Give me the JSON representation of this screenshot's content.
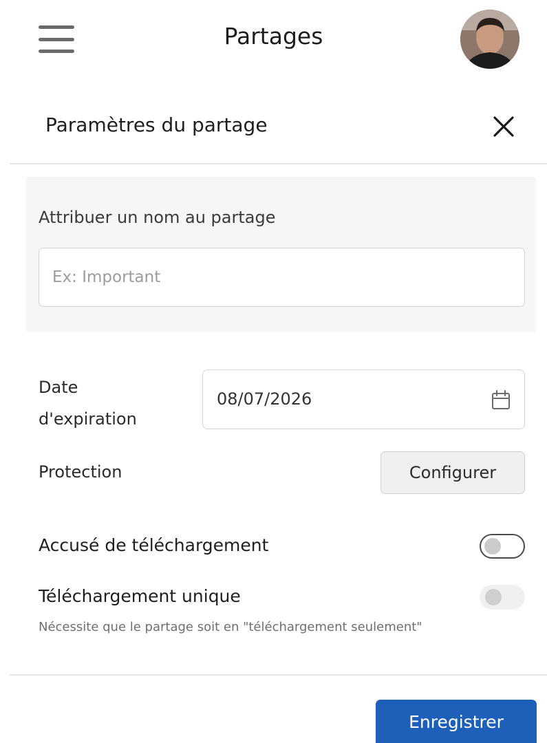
{
  "header": {
    "title": "Partages",
    "menu_icon": "hamburger-menu-icon",
    "avatar_icon": "user-avatar"
  },
  "dialog": {
    "title": "Paramètres du partage",
    "close_icon": "close-icon"
  },
  "share_name": {
    "label": "Attribuer un nom au partage",
    "value": "",
    "placeholder": "Ex: Important"
  },
  "expiration": {
    "label_line1": "Date",
    "label_line2": "d'expiration",
    "value": "08/07/2026",
    "icon": "calendar-icon"
  },
  "protection": {
    "label": "Protection",
    "button_label": "Configurer"
  },
  "download_receipt": {
    "label": "Accusé de téléchargement",
    "enabled": false
  },
  "single_download": {
    "label": "Téléchargement unique",
    "hint": "Nécessite que le partage soit en \"téléchargement seulement\"",
    "enabled": false,
    "disabled": true
  },
  "footer": {
    "save_label": "Enregistrer"
  },
  "colors": {
    "primary": "#1e5fb9",
    "divider": "#e6e6e6",
    "panel_bg": "#f6f6f6"
  }
}
